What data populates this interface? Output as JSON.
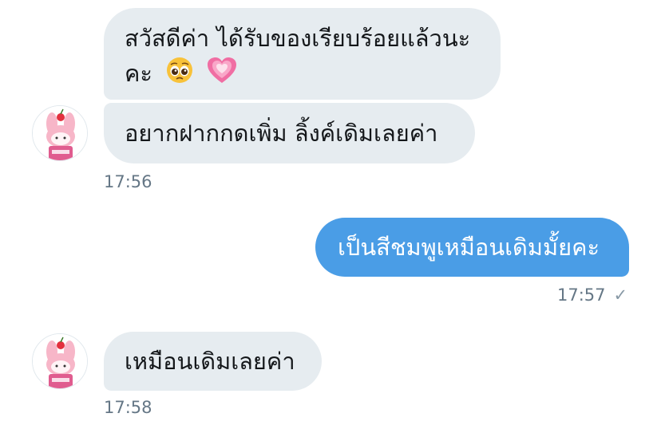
{
  "messages": [
    {
      "id": "m1",
      "text_line1": "สวัสดีค่า ได้รับของเรียบร้อยแล้วนะ",
      "text_line2": "คะ",
      "emoji_1": "pleading-face",
      "emoji_2": "growing-heart"
    },
    {
      "id": "m2",
      "text": "อยากฝากกดเพิ่ม ลิ้งค์เดิมเลยค่า"
    },
    {
      "id": "m3",
      "text": "เป็นสีชมพูเหมือนเดิมมั้ยคะ"
    },
    {
      "id": "m4",
      "text": "เหมือนเดิมเลยค่า"
    }
  ],
  "timestamps": {
    "t1": "17:56",
    "t2": "17:57",
    "t3": "17:58"
  },
  "status": {
    "read_check": "✓"
  },
  "colors": {
    "incoming_bubble": "#e6ecf0",
    "outgoing_bubble": "#4a9de6",
    "timestamp": "#657786"
  },
  "icons": {
    "avatar": "my-melody-avatar-icon",
    "check": "check-icon"
  }
}
